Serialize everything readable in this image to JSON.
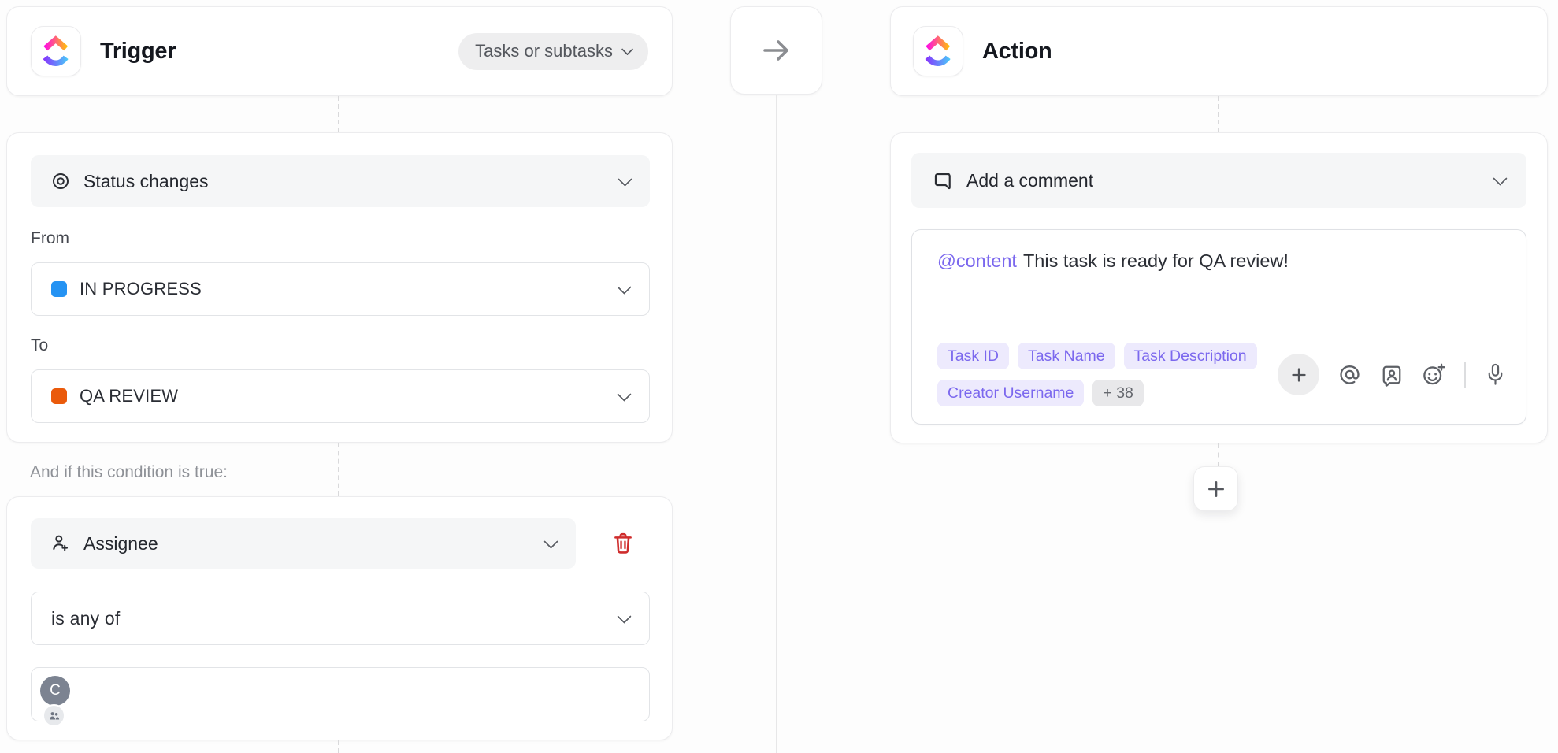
{
  "trigger": {
    "title": "Trigger",
    "scope_selector": "Tasks or subtasks",
    "event": "Status changes",
    "from_label": "From",
    "from_value": "IN PROGRESS",
    "to_label": "To",
    "to_value": "QA REVIEW",
    "condition_intro": "And if this condition is true:",
    "condition_field": "Assignee",
    "condition_operator": "is any of",
    "condition_avatar_initial": "C"
  },
  "action": {
    "title": "Action",
    "type": "Add a comment",
    "comment_mention": "@content",
    "comment_text": "This task is ready for QA review!",
    "tags": [
      "Task ID",
      "Task Name",
      "Task Description",
      "Creator Username"
    ],
    "more_tag": "+ 38"
  },
  "colors": {
    "status_from": "#2593f3",
    "status_to": "#ea5a0b",
    "accent_purple": "#7b68ee",
    "tag_bg": "#edeafd",
    "danger_red": "#cf2d2d",
    "brand_gradient_top": [
      "#FF02F0",
      "#FFC800"
    ],
    "brand_gradient_bottom": [
      "#8930FD",
      "#49CCF9"
    ]
  },
  "icons": {
    "logo": "clickup-logo",
    "event": "target-icon",
    "condition_field": "user-plus-icon",
    "delete": "trash-icon",
    "action_type": "comment-bubble-icon",
    "toolbar": [
      "plus-icon",
      "at-sign-icon",
      "clip-avatar-icon",
      "emoji-plus-icon",
      "microphone-icon"
    ],
    "connector": "arrow-right-icon",
    "avatar_badge": "people-icon"
  }
}
